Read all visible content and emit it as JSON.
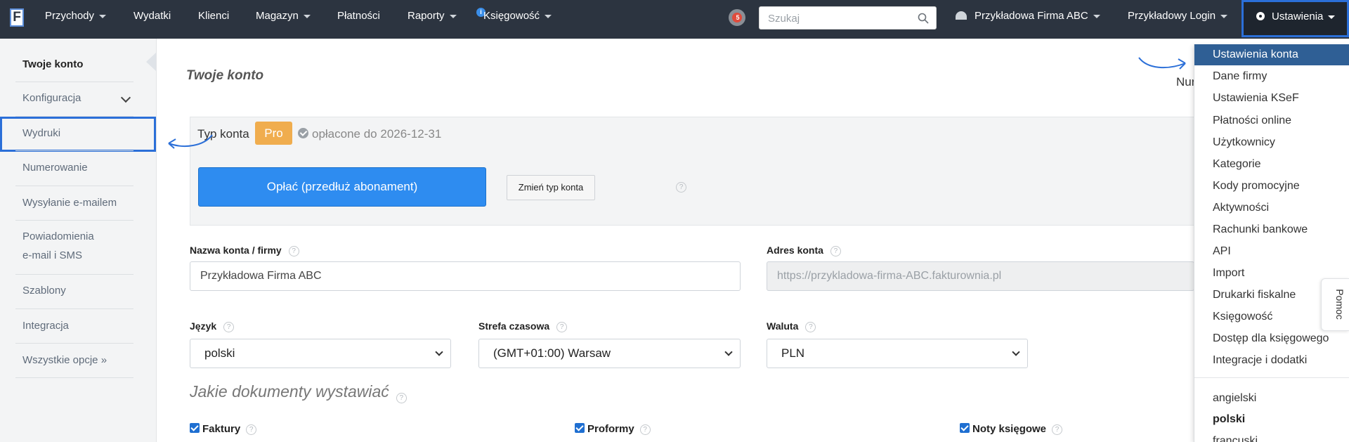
{
  "topnav": {
    "logo": "F",
    "items": [
      {
        "label": "Przychody"
      },
      {
        "label": "Wydatki"
      },
      {
        "label": "Klienci"
      },
      {
        "label": "Magazyn"
      },
      {
        "label": "Płatności"
      },
      {
        "label": "Raporty"
      },
      {
        "label": "Księgowość"
      }
    ],
    "info_badge": "i",
    "notifications_count": "5",
    "search_placeholder": "Szukaj",
    "firm": "Przykładowa Firma ABC",
    "login": "Przykładowy Login",
    "settings": "Ustawienia"
  },
  "sidebar": {
    "items": [
      {
        "label": "Twoje konto"
      },
      {
        "label": "Konfiguracja"
      },
      {
        "label": "Wydruki"
      },
      {
        "label": "Numerowanie"
      },
      {
        "label": "Wysyłanie e-mailem"
      },
      {
        "label": "Powiadomienia"
      },
      {
        "label": "e-mail i SMS"
      },
      {
        "label": "Szablony"
      },
      {
        "label": "Integracja"
      },
      {
        "label": "Wszystkie opcje »"
      }
    ]
  },
  "main": {
    "title": "Twoje konto",
    "num_partial": "Nur",
    "account_type_label": "Typ konta",
    "account_type_badge": "Pro",
    "paid_text": "opłacone do 2026-12-31",
    "pay_button": "Opłać (przedłuż abonament)",
    "change_button": "Zmień typ konta",
    "help_glyph": "?",
    "name_label": "Nazwa konta / firmy",
    "name_value": "Przykładowa Firma ABC",
    "address_label": "Adres konta",
    "address_value": "https://przykladowa-firma-ABC.fakturownia.pl",
    "language_label": "Język",
    "language_value": "polski",
    "timezone_label": "Strefa czasowa",
    "timezone_value": "(GMT+01:00) Warsaw",
    "currency_label": "Waluta",
    "currency_value": "PLN",
    "documents_title": "Jakie dokumenty wystawiać",
    "doc_types": [
      {
        "label": "Faktury",
        "checked": true
      },
      {
        "label": "Proformy",
        "checked": true
      },
      {
        "label": "Noty księgowe",
        "checked": true
      }
    ]
  },
  "dropdown": {
    "items": [
      {
        "label": "Ustawienia konta"
      },
      {
        "label": "Dane firmy"
      },
      {
        "label": "Ustawienia KSeF"
      },
      {
        "label": "Płatności online"
      },
      {
        "label": "Użytkownicy"
      },
      {
        "label": "Kategorie"
      },
      {
        "label": "Kody promocyjne"
      },
      {
        "label": "Aktywności"
      },
      {
        "label": "Rachunki bankowe"
      },
      {
        "label": "API"
      },
      {
        "label": "Import"
      },
      {
        "label": "Drukarki fiskalne"
      },
      {
        "label": "Księgowość"
      },
      {
        "label": "Dostęp dla księgowego"
      },
      {
        "label": "Integracje i dodatki"
      }
    ],
    "languages": [
      {
        "label": "angielski"
      },
      {
        "label": "polski"
      },
      {
        "label": "francuski"
      }
    ]
  },
  "help_tab": "Pomoc",
  "colors": {
    "nav_bg": "#2c3440",
    "accent_blue": "#2e8cf0",
    "highlight_outline": "#2b6fd8",
    "pro_badge": "#f0ad4e",
    "dropdown_active": "#2f5f95"
  }
}
